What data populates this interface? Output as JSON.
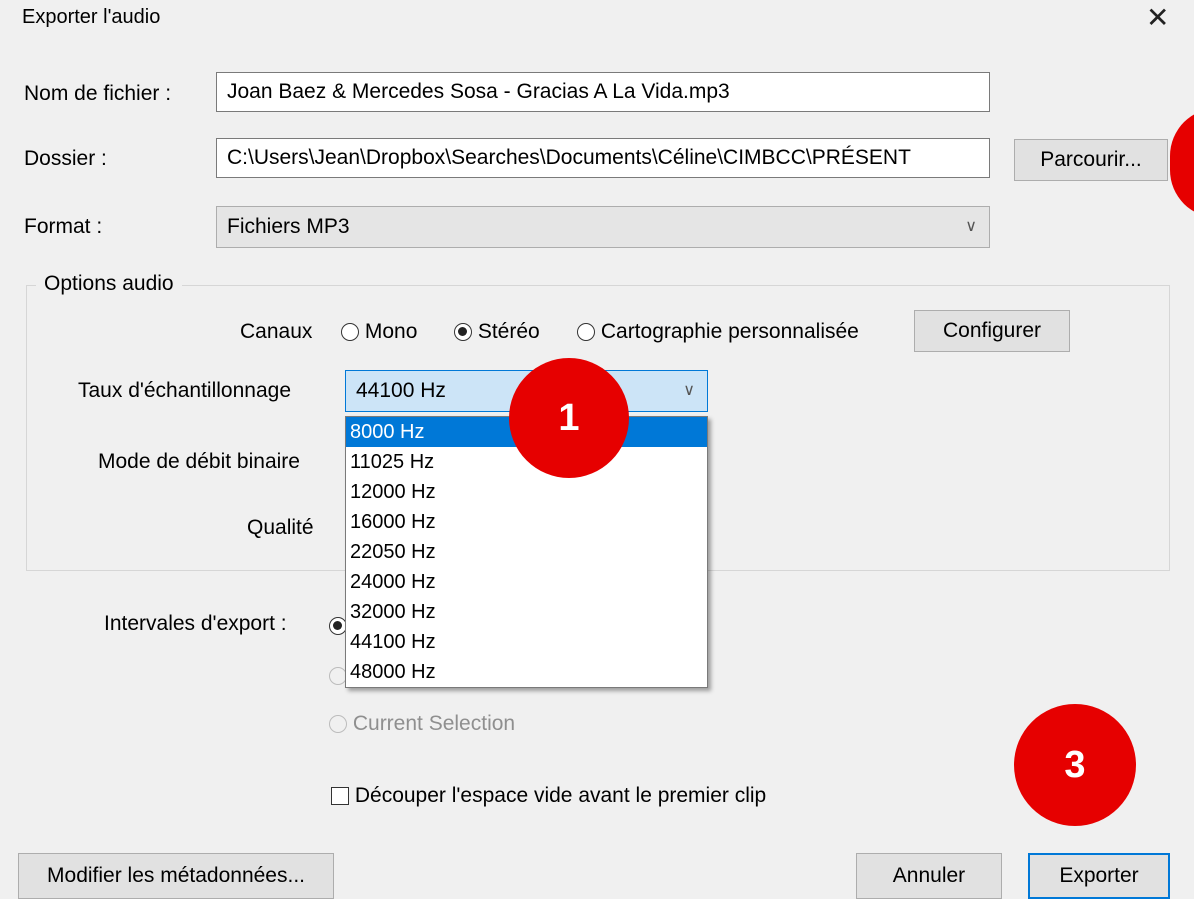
{
  "dialog": {
    "title": "Exporter l'audio",
    "close_glyph": "✕"
  },
  "file": {
    "name_label": "Nom de fichier :",
    "name_value": "Joan Baez & Mercedes Sosa - Gracias A La Vida.mp3",
    "folder_label": "Dossier :",
    "folder_value": "C:\\Users\\Jean\\Dropbox\\Searches\\Documents\\Céline\\CIMBCC\\PRÉSENT",
    "browse_label": "Parcourir...",
    "format_label": "Format :",
    "format_value": "Fichiers MP3"
  },
  "audio_options": {
    "group_title": "Options audio",
    "channels_label": "Canaux",
    "mono_label": "Mono",
    "stereo_label": "Stéréo",
    "custom_label": "Cartographie personnalisée",
    "configure_label": "Configurer",
    "sample_rate_label": "Taux d'échantillonnage",
    "sample_rate_value": "44100 Hz",
    "sample_rate_options": [
      "8000 Hz",
      "11025 Hz",
      "12000 Hz",
      "16000 Hz",
      "22050 Hz",
      "24000 Hz",
      "32000 Hz",
      "44100 Hz",
      "48000 Hz"
    ],
    "highlighted_option": "8000 Hz",
    "bitrate_mode_label": "Mode de débit binaire",
    "quality_label": "Qualité"
  },
  "export_range": {
    "label": "Intervales d'export :",
    "current_selection_label": "Current Selection"
  },
  "trim": {
    "label": "Découper l'espace vide avant le premier clip",
    "checked": false
  },
  "footer": {
    "metadata_label": "Modifier les métadonnées...",
    "cancel_label": "Annuler",
    "export_label": "Exporter"
  },
  "annotations": {
    "badge_1": "1",
    "badge_3": "3",
    "badge_color": "#e60000"
  },
  "icons": {
    "chevron": "chevron-down-icon",
    "close": "close-icon"
  }
}
